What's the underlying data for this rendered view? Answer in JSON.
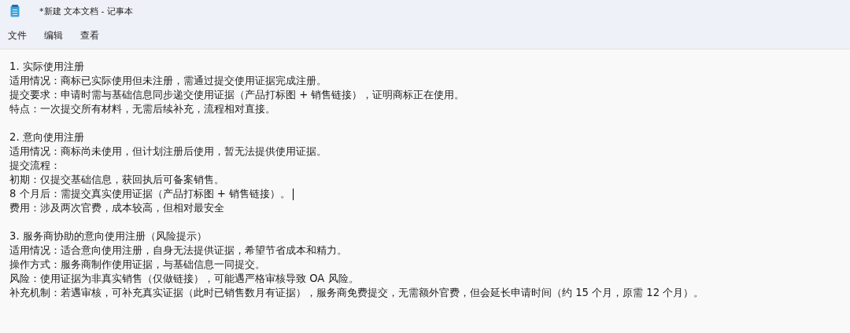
{
  "window": {
    "title": "*新建 文本文档 - 记事本"
  },
  "menu": [
    {
      "label": "文件"
    },
    {
      "label": "编辑"
    },
    {
      "label": "查看"
    }
  ],
  "document": {
    "sections": [
      {
        "lines": [
          {
            "text": "1. 实际使用注册",
            "caret": false
          },
          {
            "text": "适用情况：商标已实际使用但未注册，需通过提交使用证据完成注册。",
            "caret": false
          },
          {
            "text": "提交要求：申请时需与基础信息同步递交使用证据（产品打标图 + 销售链接），证明商标正在使用。",
            "caret": false
          },
          {
            "text": "特点：一次提交所有材料，无需后续补充，流程相对直接。",
            "caret": false
          }
        ]
      },
      {
        "lines": [
          {
            "text": "2. 意向使用注册",
            "caret": false
          },
          {
            "text": "适用情况：商标尚未使用，但计划注册后使用，暂无法提供使用证据。",
            "caret": false
          },
          {
            "text": "提交流程：",
            "caret": false
          },
          {
            "text": "初期：仅提交基础信息，获回执后可备案销售。",
            "caret": false
          },
          {
            "text": "8 个月后：需提交真实使用证据（产品打标图 + 销售链接）。",
            "caret": true
          },
          {
            "text": "费用：涉及两次官费，成本较高，但相对最安全",
            "caret": false
          }
        ]
      },
      {
        "lines": [
          {
            "text": "3. 服务商协助的意向使用注册（风险提示）",
            "caret": false
          },
          {
            "text": "适用情况：适合意向使用注册，自身无法提供证据，希望节省成本和精力。",
            "caret": false
          },
          {
            "text": "操作方式：服务商制作使用证据，与基础信息一同提交。",
            "caret": false
          },
          {
            "text": "风险：使用证据为非真实销售（仅做链接），可能遇严格审核导致 OA 风险。",
            "caret": false
          },
          {
            "text": "补充机制：若遇审核，可补充真实证据（此时已销售数月有证据），服务商免费提交，无需额外官费，但会延长申请时间（约 15 个月，原需 12 个月）。",
            "caret": false
          }
        ]
      }
    ]
  }
}
